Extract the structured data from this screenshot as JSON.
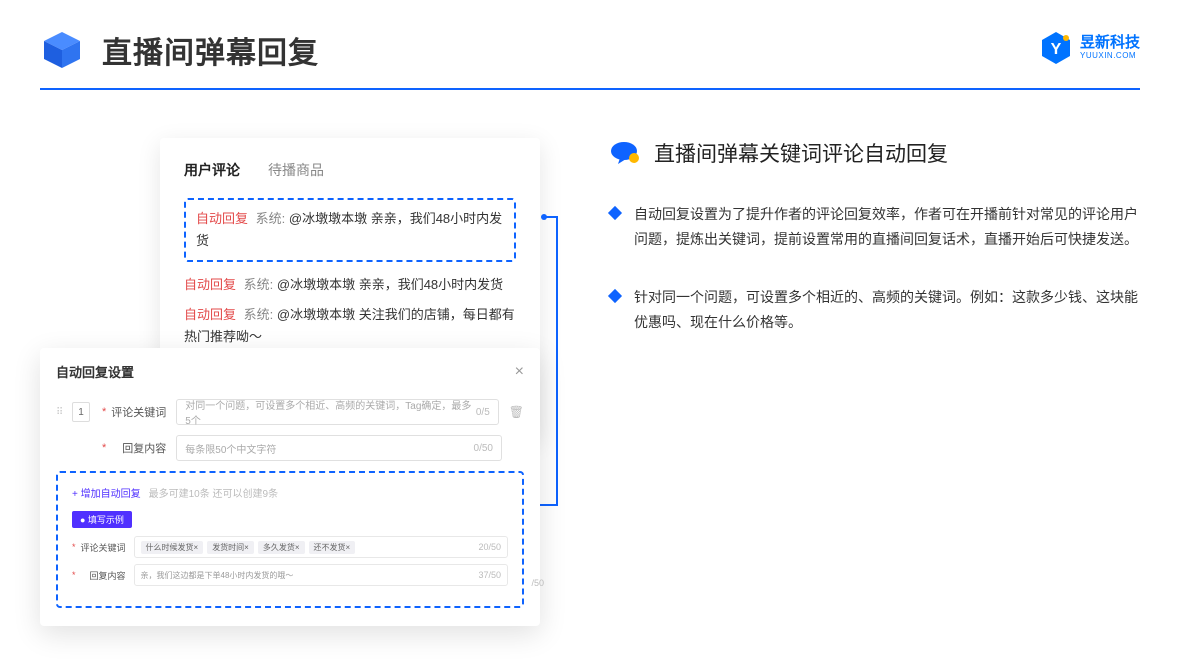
{
  "header": {
    "title": "直播间弹幕回复"
  },
  "brand": {
    "cn": "昱新科技",
    "en": "YUUXIN.COM"
  },
  "leftPanel": {
    "tabs": {
      "active": "用户评论",
      "inactive": "待播商品"
    },
    "reply1": {
      "auto": "自动回复",
      "sys": "系统:",
      "text": "@冰墩墩本墩 亲亲，我们48小时内发货"
    },
    "reply2": {
      "auto": "自动回复",
      "sys": "系统:",
      "text": "@冰墩墩本墩 亲亲，我们48小时内发货"
    },
    "reply3": {
      "auto": "自动回复",
      "sys": "系统:",
      "text": "@冰墩墩本墩 关注我们的店铺，每日都有热门推荐呦～"
    }
  },
  "frontPanel": {
    "title": "自动回复设置",
    "index": "1",
    "label1": "评论关键词",
    "placeholder1": "对同一个问题，可设置多个相近、高频的关键词，Tag确定，最多5个",
    "count1": "0/5",
    "label2": "回复内容",
    "placeholder2": "每条限50个中文字符",
    "count2": "0/50",
    "addLink": "+ 增加自动回复",
    "addNote": "最多可建10条 还可以创建9条",
    "exBadge": "● 填写示例",
    "exLabel1": "评论关键词",
    "exTags": [
      "什么时候发货×",
      "发货时间×",
      "多久发货×",
      "还不发货×"
    ],
    "exCount1": "20/50",
    "exLabel2": "回复内容",
    "exText2": "亲，我们这边都是下单48小时内发货的哦～",
    "exCount2": "37/50",
    "outCount": "/50"
  },
  "right": {
    "title": "直播间弹幕关键词评论自动回复",
    "bullet1": "自动回复设置为了提升作者的评论回复效率，作者可在开播前针对常见的评论用户问题，提炼出关键词，提前设置常用的直播间回复话术，直播开始后可快捷发送。",
    "bullet2": "针对同一个问题，可设置多个相近的、高频的关键词。例如：这款多少钱、这块能优惠吗、现在什么价格等。"
  }
}
